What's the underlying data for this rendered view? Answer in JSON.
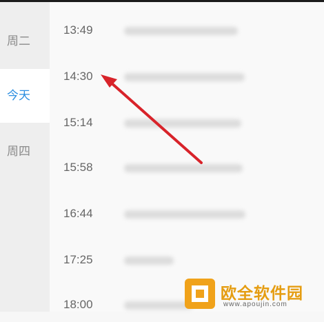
{
  "sidebar": {
    "days": [
      {
        "label": "周二",
        "active": false
      },
      {
        "label": "今天",
        "active": true
      },
      {
        "label": "周四",
        "active": false
      }
    ]
  },
  "records": [
    {
      "time": "13:49"
    },
    {
      "time": "14:30"
    },
    {
      "time": "15:14"
    },
    {
      "time": "15:58"
    },
    {
      "time": "16:44"
    },
    {
      "time": "17:25"
    },
    {
      "time": "18:00"
    }
  ],
  "watermark": {
    "title": "欧全软件园",
    "url": "www.apoujin.com"
  },
  "colors": {
    "active_day": "#2a8de0",
    "arrow": "#d8232a",
    "watermark": "#e59d12"
  }
}
